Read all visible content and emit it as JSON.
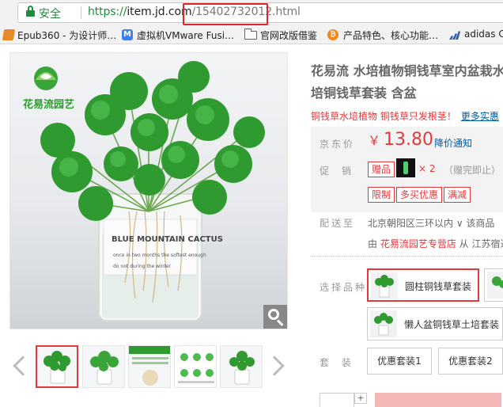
{
  "browser": {
    "secure_label": "安全",
    "url_scheme": "https://",
    "url_host": "item.jd.com",
    "url_path_id": "/15402732012.",
    "url_path_ext": "html"
  },
  "bookmarks": [
    {
      "label": "Epub360 - 为设计师…",
      "icon": "epub-icon"
    },
    {
      "label": "虚拟机VMware Fusi…",
      "icon": "vmware-icon"
    },
    {
      "label": "官网改版借鉴",
      "icon": "folder-icon"
    },
    {
      "label": "产品特色、核心功能…",
      "icon": "b-icon"
    },
    {
      "label": "adidas C",
      "icon": "adidas-icon"
    }
  ],
  "gallery": {
    "logo_text": "花易流园艺",
    "pot_label_1": "BLUE MOUNTAIN  CACTUS",
    "pot_label_2": "once in two months the softest enough",
    "pot_label_3": "do not during the winter",
    "bottom_hint": "✓ ★ ✓"
  },
  "product": {
    "title": "花易流 水培植物铜钱草室内盆栽水培铜钱草套装 含盆",
    "subtitle": "铜钱草水培植物 铜钱草只发根茎！",
    "subtitle_more": "更多实惠",
    "price_label": "京东价",
    "price_currency": "￥",
    "price_value": "13.80",
    "price_notify": "降价通知",
    "promo_label": "促销",
    "gift_tag": "赠品",
    "gift_qty": "× 2",
    "gift_note": "（赠完即止）",
    "promo_tags": [
      "限制",
      "多买优惠",
      "满减"
    ],
    "ship_label": "配送至",
    "ship_location": "北京朝阳区三环以内 ∨  该商品",
    "ship_prefix": "由 ",
    "ship_seller": "花易流园艺专营店",
    "ship_suffix": " 从 江苏宿迁",
    "option_label": "选择品种",
    "options": [
      "圆柱铜钱草套装",
      "懒人盆铜钱草土培套装"
    ],
    "suit_label": "套装",
    "suits": [
      "优惠套装1",
      "优惠套装2"
    ],
    "qty_plus": "+"
  },
  "colors": {
    "jd_red": "#e4393c",
    "link_blue": "#005aa0",
    "secure_green": "#1e8e3e"
  }
}
